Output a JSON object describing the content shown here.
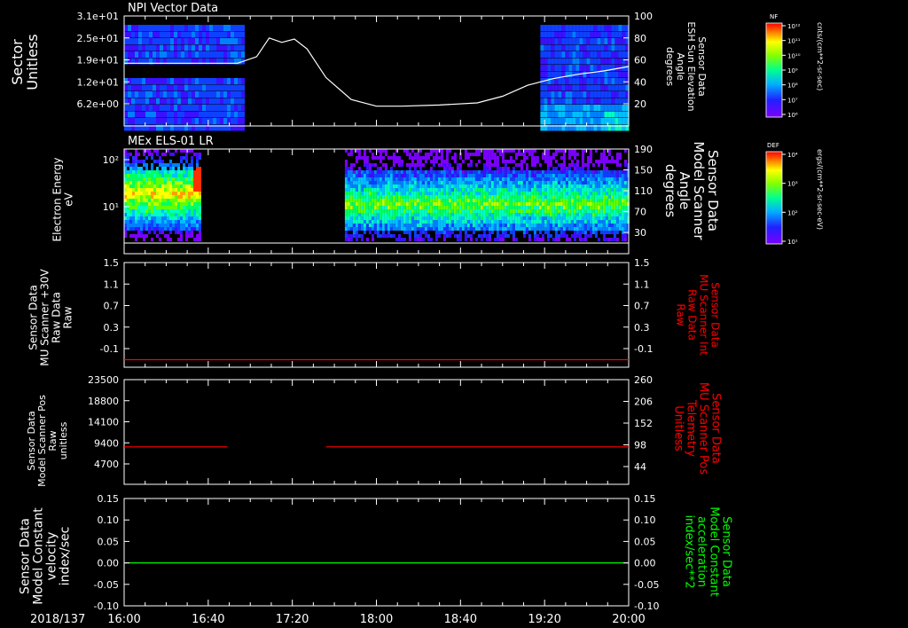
{
  "page": {
    "date_label": "2018/137",
    "x_tick_labels": [
      "16:00",
      "16:40",
      "17:20",
      "18:00",
      "18:40",
      "19:20",
      "20:00"
    ]
  },
  "colors": {
    "background": "#000000",
    "axis": "#ffffff",
    "red_trace": "#ff0000",
    "green_trace": "#00ff00"
  },
  "chart_data": [
    {
      "type": "heatmap",
      "title": "NPI Vector Data",
      "ylabel_left": [
        "Sector",
        "Unitless"
      ],
      "ylabel_right": [
        "Sensor Data",
        "ESH Sun Elevation",
        "Angle",
        "degrees"
      ],
      "y_ticks_left": [
        "3.1e+01",
        "2.5e+01",
        "1.9e+01",
        "1.2e+01",
        "6.2e+00"
      ],
      "y_ticks_right": [
        "100",
        "80",
        "60",
        "40",
        "20"
      ],
      "ylim_right": [
        0,
        100
      ],
      "data_coverage_hours": [
        [
          16.0,
          16.95
        ],
        [
          19.3,
          20.0
        ]
      ],
      "overlay_line": {
        "name": "ESH Sun Elevation Angle",
        "x_hours": [
          16.0,
          16.5,
          16.9,
          17.05,
          17.15,
          17.25,
          17.35,
          17.45,
          17.6,
          17.8,
          18.0,
          18.2,
          18.5,
          18.8,
          19.0,
          19.2,
          19.4,
          19.6,
          19.8,
          20.0
        ],
        "y": [
          57,
          57,
          57,
          63,
          80,
          76,
          79,
          70,
          44,
          24,
          18,
          18,
          19,
          21,
          27,
          37,
          43,
          47,
          50,
          54
        ]
      },
      "colorbar": {
        "label": "NF",
        "units": "cnts/(cm**2-sr-sec)",
        "ticks": [
          "10¹²",
          "10¹¹",
          "10¹⁰",
          "10⁹",
          "10⁸",
          "10⁷",
          "10⁶"
        ]
      }
    },
    {
      "type": "heatmap",
      "title": "MEx ELS-01 LR",
      "ylabel_left": [
        "Electron Energy",
        "eV"
      ],
      "ylabel_right": [
        "Sensor Data",
        "Model Scanner",
        "Angle",
        "degrees"
      ],
      "y_ticks_left": [
        "10²",
        "10¹"
      ],
      "y_ticks_right": [
        "190",
        "150",
        "110",
        "70",
        "30"
      ],
      "data_coverage_hours": [
        [
          16.0,
          16.6
        ],
        [
          17.75,
          20.0
        ]
      ],
      "colorbar": {
        "label": "DEF",
        "units": "ergs/(cm**2-sr-sec-eV)",
        "ticks": [
          "10⁴",
          "10³",
          "10²",
          "10¹"
        ]
      }
    },
    {
      "type": "line",
      "ylabel_left": [
        "Sensor Data",
        "MU Scanner +30V",
        "Raw Data",
        "Raw"
      ],
      "ylabel_right": [
        "Sensor Data",
        "MU Scanner Int",
        "Raw Data",
        "Raw"
      ],
      "y_ticks": [
        "1.5",
        "1.1",
        "0.7",
        "0.3",
        "-0.1"
      ],
      "ylim": [
        -0.3,
        1.5
      ],
      "series": [
        {
          "x_hours": [
            16.0,
            20.0
          ],
          "y": [
            -0.17,
            -0.17
          ],
          "color": "#ff0000"
        }
      ]
    },
    {
      "type": "line",
      "ylabel_left": [
        "Sensor Data",
        "Model Scanner Pos",
        "Raw",
        "unitless"
      ],
      "ylabel_right": [
        "Sensor Data",
        "MU Scanner Pos",
        "Telemetry",
        "Unitless"
      ],
      "y_ticks_left": [
        "23500",
        "18800",
        "14100",
        "9400",
        "4700"
      ],
      "y_ticks_right": [
        "260",
        "206",
        "152",
        "98",
        "44"
      ],
      "ylim": [
        0,
        23500
      ],
      "series": [
        {
          "x_hours": [
            16.0,
            16.82
          ],
          "y": [
            8400,
            8400
          ],
          "color": "#ff0000"
        },
        {
          "x_hours": [
            17.6,
            20.0
          ],
          "y": [
            8400,
            8400
          ],
          "color": "#ff0000"
        }
      ]
    },
    {
      "type": "line",
      "ylabel_left": [
        "Sensor Data",
        "Model Constant",
        "velocity",
        "index/sec"
      ],
      "ylabel_right": [
        "Sensor Data",
        "Model Constant",
        "acceleration",
        "index/sec**2"
      ],
      "y_ticks": [
        "0.15",
        "0.10",
        "0.05",
        "0.00",
        "-0.05",
        "-0.10"
      ],
      "ylim": [
        -0.1,
        0.15
      ],
      "series": [
        {
          "x_hours": [
            16.0,
            20.0
          ],
          "y": [
            0.0,
            0.0
          ],
          "color": "#00ff00"
        }
      ]
    }
  ]
}
